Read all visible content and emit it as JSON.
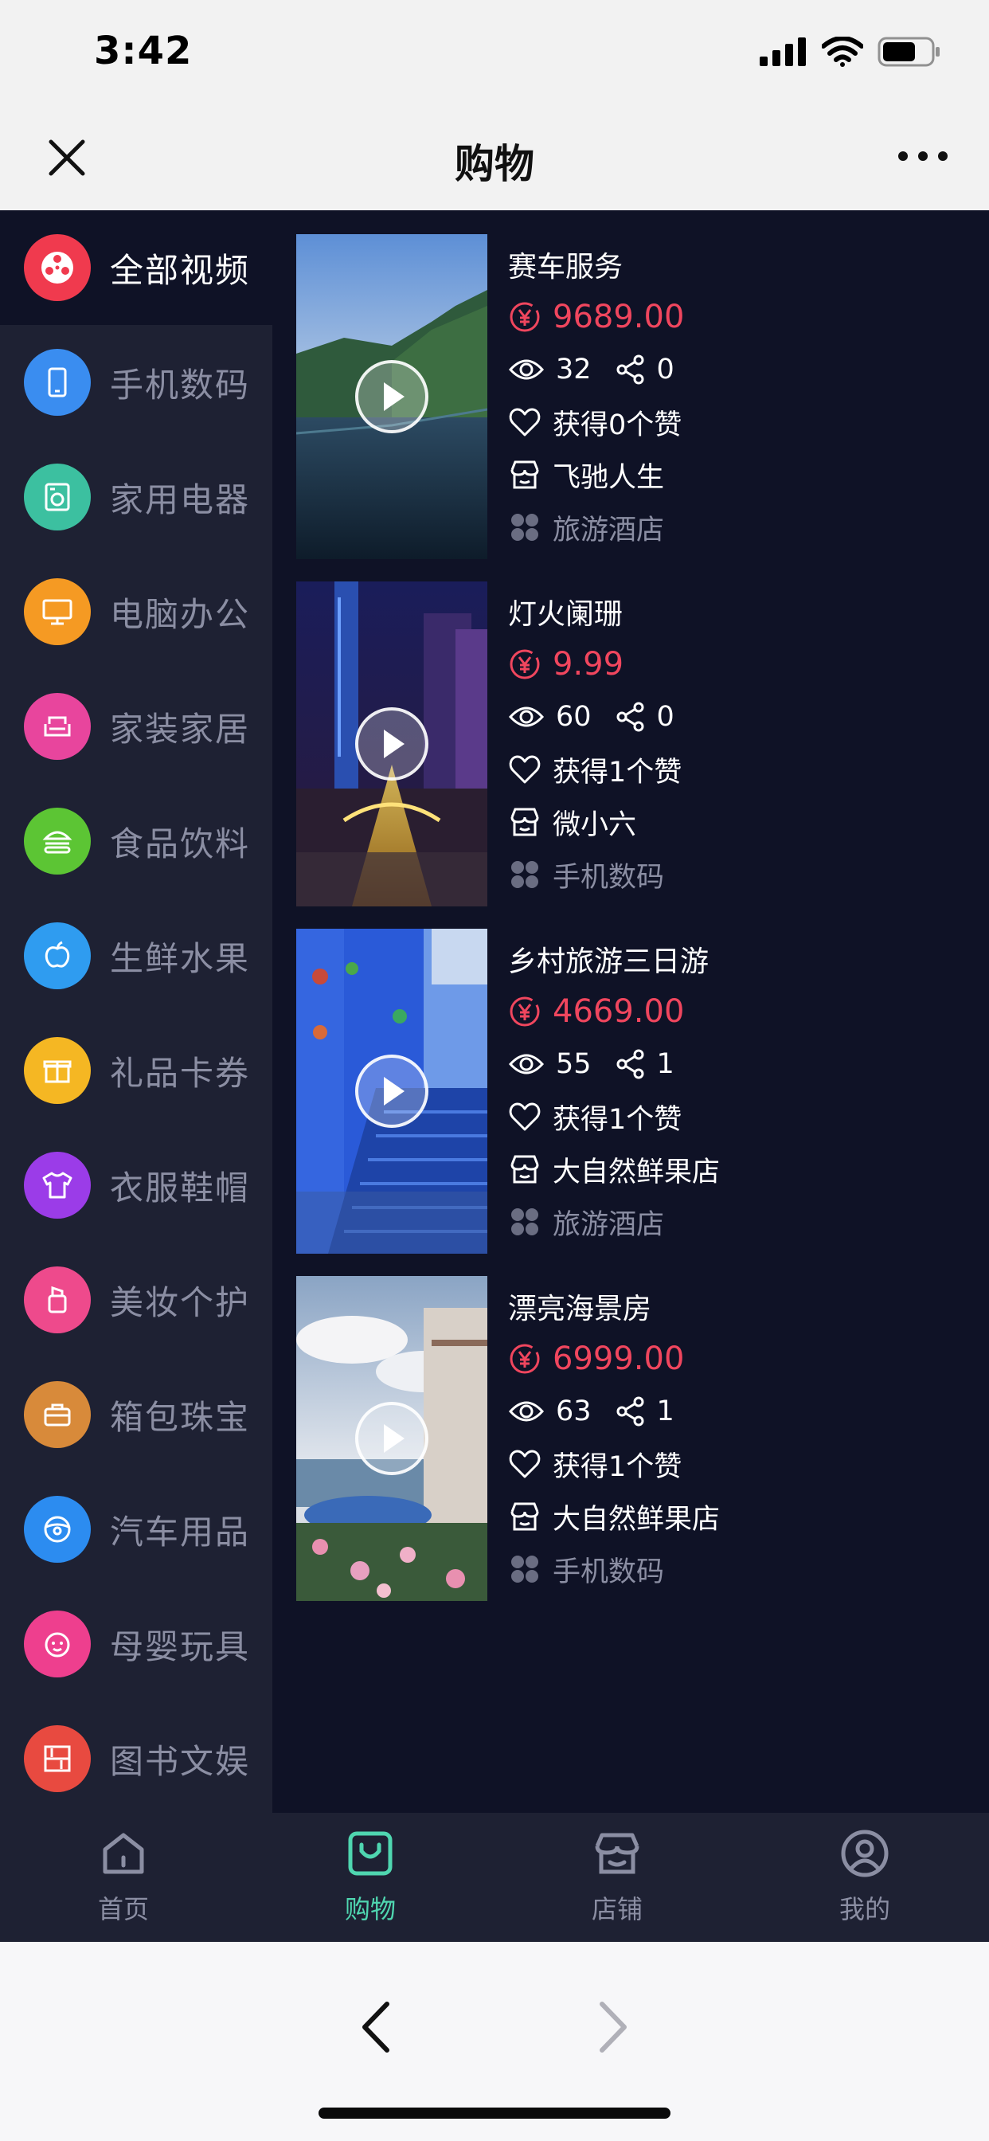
{
  "status_bar": {
    "time": "3:42"
  },
  "nav": {
    "title": "购物"
  },
  "sidebar": {
    "items": [
      {
        "label": "全部视频",
        "icon": "film-reel-icon",
        "color": "#f03a4e",
        "active": true
      },
      {
        "label": "手机数码",
        "icon": "phone-icon",
        "color": "#3a8df0"
      },
      {
        "label": "家用电器",
        "icon": "washing-machine-icon",
        "color": "#3cc0a0"
      },
      {
        "label": "电脑办公",
        "icon": "monitor-icon",
        "color": "#f59a23"
      },
      {
        "label": "家装家居",
        "icon": "sofa-icon",
        "color": "#e8459d"
      },
      {
        "label": "食品饮料",
        "icon": "burger-icon",
        "color": "#5cc534"
      },
      {
        "label": "生鲜水果",
        "icon": "apple-icon",
        "color": "#2f9cf0"
      },
      {
        "label": "礼品卡券",
        "icon": "gift-icon",
        "color": "#f5b723"
      },
      {
        "label": "衣服鞋帽",
        "icon": "tshirt-icon",
        "color": "#9b3ce8"
      },
      {
        "label": "美妆个护",
        "icon": "cosmetics-icon",
        "color": "#ee4a8c"
      },
      {
        "label": "箱包珠宝",
        "icon": "bag-icon",
        "color": "#d88a3a"
      },
      {
        "label": "汽车用品",
        "icon": "steering-wheel-icon",
        "color": "#2c8cf0"
      },
      {
        "label": "母婴玩具",
        "icon": "baby-icon",
        "color": "#ee3f8e"
      },
      {
        "label": "图书文娱",
        "icon": "bookshelf-icon",
        "color": "#e84a40"
      }
    ]
  },
  "feed": {
    "items": [
      {
        "title": "赛车服务",
        "price": "9689.00",
        "views": "32",
        "shares": "0",
        "likes": "获得0个赞",
        "shop": "飞驰人生",
        "category": "旅游酒店",
        "thumb": "coast"
      },
      {
        "title": "灯火阑珊",
        "price": "9.99",
        "views": "60",
        "shares": "0",
        "likes": "获得1个赞",
        "shop": "微小六",
        "category": "手机数码",
        "thumb": "night"
      },
      {
        "title": "乡村旅游三日游",
        "price": "4669.00",
        "views": "55",
        "shares": "1",
        "likes": "获得1个赞",
        "shop": "大自然鲜果店",
        "category": "旅游酒店",
        "thumb": "blue"
      },
      {
        "title": "漂亮海景房",
        "price": "6999.00",
        "views": "63",
        "shares": "1",
        "likes": "获得1个赞",
        "shop": "大自然鲜果店",
        "category": "手机数码",
        "thumb": "sea"
      }
    ]
  },
  "tabs": [
    {
      "label": "首页",
      "icon": "home-icon"
    },
    {
      "label": "购物",
      "icon": "shopping-bag-icon",
      "active": true
    },
    {
      "label": "店铺",
      "icon": "store-icon"
    },
    {
      "label": "我的",
      "icon": "user-icon"
    }
  ],
  "colors": {
    "accent": "#4fd6b0",
    "price": "#f0465e",
    "background": "#0f1226",
    "sidebar": "#1e2133"
  }
}
